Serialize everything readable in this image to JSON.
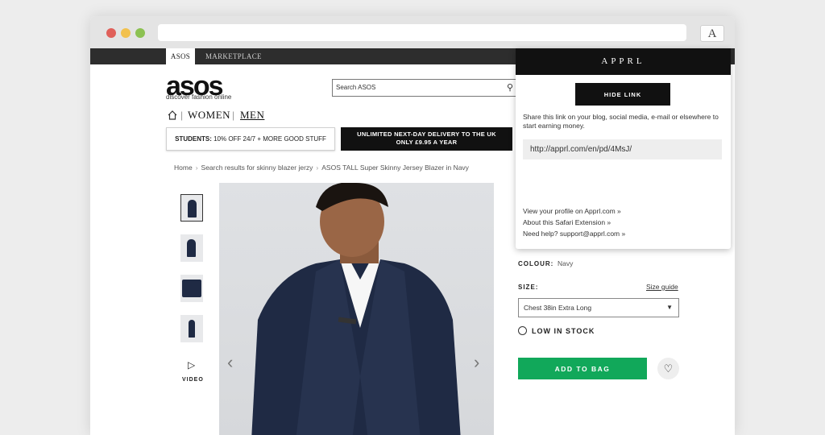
{
  "browser": {
    "extension_icon_letter": "A"
  },
  "topnav": {
    "tab_asos": "ASOS",
    "tab_marketplace": "MARKETPLACE"
  },
  "header": {
    "logo": "asos",
    "tagline": "discover fashion online",
    "search_placeholder": "Search ASOS",
    "nav_women": "WOMEN",
    "nav_men": "MEN"
  },
  "promos": {
    "students_bold": "STUDENTS:",
    "students_text": " 10% OFF 24/7 + MORE GOOD STUFF",
    "delivery_line1": "UNLIMITED NEXT-DAY DELIVERY TO THE UK",
    "delivery_line2": "ONLY £9.95 A YEAR"
  },
  "breadcrumb": {
    "home": "Home",
    "search": "Search results for skinny blazer jerzy",
    "product": "ASOS TALL Super Skinny Jersey Blazer in Navy"
  },
  "gallery": {
    "video_label": "VIDEO"
  },
  "product": {
    "colour_label": "COLOUR:",
    "colour_value": "Navy",
    "size_label": "SIZE:",
    "size_guide": "Size guide",
    "size_selected": "Chest 38in Extra Long",
    "stock": "LOW IN STOCK",
    "add_to_bag": "ADD TO BAG"
  },
  "popup": {
    "title": "APPRL",
    "hide_link": "HIDE LINK",
    "share_text": "Share this link on your blog, social media, e-mail or elsewhere to start earning money.",
    "link": "http://apprl.com/en/pd/4MsJ/",
    "links": [
      "View your profile on Apprl.com »",
      "About this Safari Extension »",
      "Need help? support@apprl.com »"
    ]
  },
  "colors": {
    "add_to_bag": "#11a85a",
    "dark": "#111111"
  }
}
